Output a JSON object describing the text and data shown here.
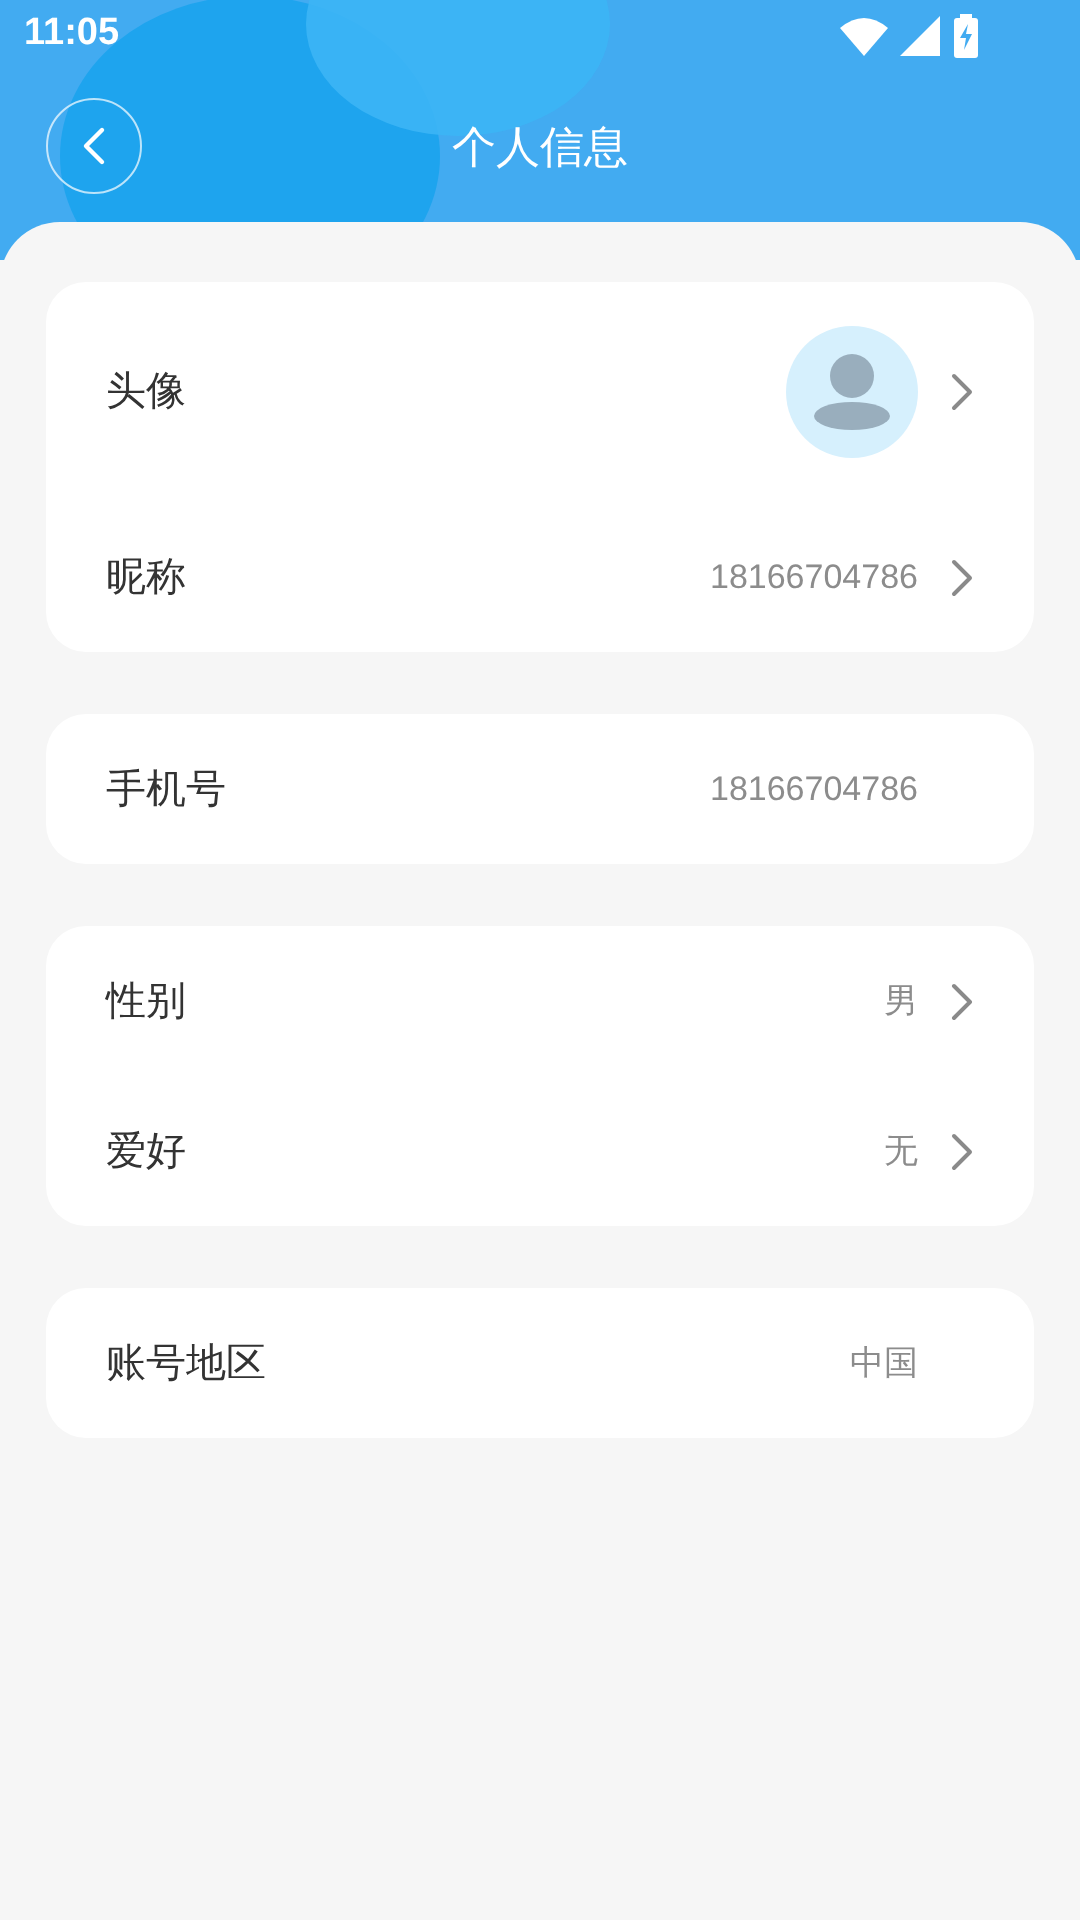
{
  "status_bar": {
    "time": "11:05"
  },
  "header": {
    "title": "个人信息"
  },
  "groups": [
    {
      "rows": [
        {
          "kind": "avatar",
          "label": "头像",
          "arrow": true
        },
        {
          "kind": "text",
          "label": "昵称",
          "value": "18166704786",
          "arrow": true
        }
      ]
    },
    {
      "rows": [
        {
          "kind": "text",
          "label": "手机号",
          "value": "18166704786",
          "arrow": false
        }
      ]
    },
    {
      "rows": [
        {
          "kind": "text",
          "label": "性别",
          "value": "男",
          "arrow": true
        },
        {
          "kind": "text",
          "label": "爱好",
          "value": "无",
          "arrow": true
        }
      ]
    },
    {
      "rows": [
        {
          "kind": "text",
          "label": "账号地区",
          "value": "中国",
          "arrow": false
        }
      ]
    }
  ]
}
